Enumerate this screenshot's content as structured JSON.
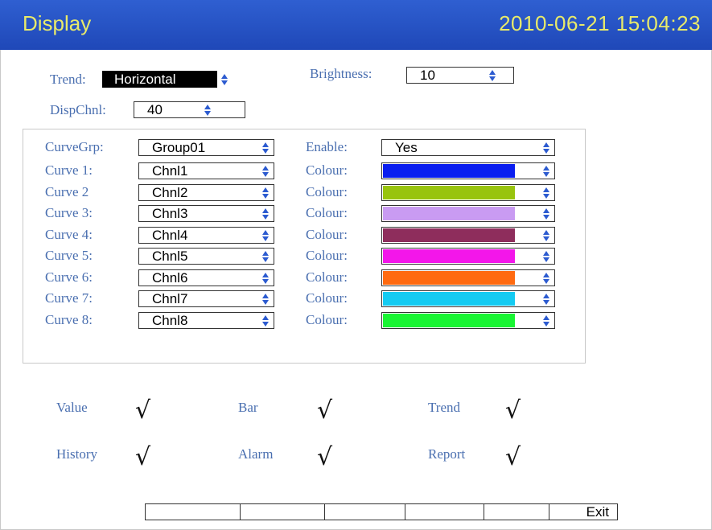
{
  "header": {
    "title": "Display",
    "datetime": "2010-06-21 15:04:23"
  },
  "settings": {
    "trend_label": "Trend:",
    "trend_value": "Horizontal",
    "brightness_label": "Brightness:",
    "brightness_value": "10",
    "dispchnl_label": "DispChnl:",
    "dispchnl_value": "40"
  },
  "group": {
    "curvegrp_label": "CurveGrp:",
    "curvegrp_value": "Group01",
    "enable_label": "Enable:",
    "enable_value": "Yes",
    "curves": [
      {
        "label": "Curve 1:",
        "channel": "Chnl1",
        "colour_label": "Colour:",
        "color": "#0a1ef0"
      },
      {
        "label": "Curve 2",
        "channel": "Chnl2",
        "colour_label": "Colour:",
        "color": "#98c40e"
      },
      {
        "label": "Curve 3:",
        "channel": "Chnl3",
        "colour_label": "Colour:",
        "color": "#c99bf2"
      },
      {
        "label": "Curve 4:",
        "channel": "Chnl4",
        "colour_label": "Colour:",
        "color": "#8e2d5c"
      },
      {
        "label": "Curve 5:",
        "channel": "Chnl5",
        "colour_label": "Colour:",
        "color": "#f316ea"
      },
      {
        "label": "Curve 6:",
        "channel": "Chnl6",
        "colour_label": "Colour:",
        "color": "#ff6a10"
      },
      {
        "label": "Curve 7:",
        "channel": "Chnl7",
        "colour_label": "Colour:",
        "color": "#14cbf2"
      },
      {
        "label": "Curve 8:",
        "channel": "Chnl8",
        "colour_label": "Colour:",
        "color": "#18f532"
      }
    ]
  },
  "views": [
    {
      "label": "Value",
      "checked": true
    },
    {
      "label": "Bar",
      "checked": true
    },
    {
      "label": "Trend",
      "checked": true
    },
    {
      "label": "History",
      "checked": true
    },
    {
      "label": "Alarm",
      "checked": true
    },
    {
      "label": "Report",
      "checked": true
    }
  ],
  "check_glyph": "√",
  "function_keys": [
    "",
    "",
    "",
    "",
    "",
    "",
    "Exit"
  ]
}
